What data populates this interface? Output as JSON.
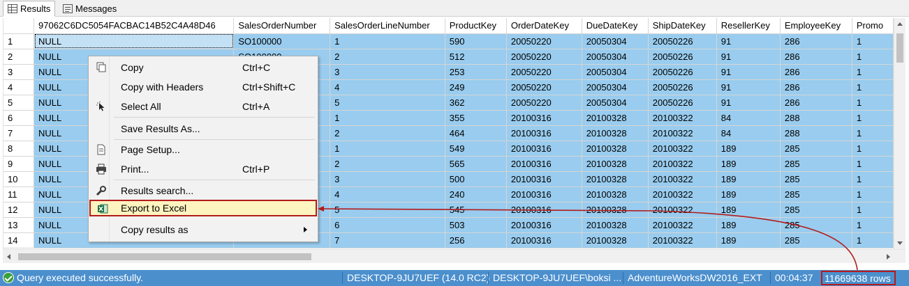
{
  "tabs": [
    {
      "label": "Results",
      "icon": "grid-icon",
      "active": true
    },
    {
      "label": "Messages",
      "icon": "message-icon",
      "active": false
    }
  ],
  "grid": {
    "columns": [
      "",
      "97062C6DC5054FACBAC14B52C4A48D46",
      "SalesOrderNumber",
      "SalesOrderLineNumber",
      "ProductKey",
      "OrderDateKey",
      "DueDateKey",
      "ShipDateKey",
      "ResellerKey",
      "EmployeeKey",
      "Promo"
    ],
    "rows": [
      [
        "1",
        "NULL",
        "SO100000",
        "1",
        "590",
        "20050220",
        "20050304",
        "20050226",
        "91",
        "286",
        "1"
      ],
      [
        "2",
        "NULL",
        "SO100000",
        "2",
        "512",
        "20050220",
        "20050304",
        "20050226",
        "91",
        "286",
        "1"
      ],
      [
        "3",
        "NULL",
        "",
        "3",
        "253",
        "20050220",
        "20050304",
        "20050226",
        "91",
        "286",
        "1"
      ],
      [
        "4",
        "NULL",
        "",
        "4",
        "249",
        "20050220",
        "20050304",
        "20050226",
        "91",
        "286",
        "1"
      ],
      [
        "5",
        "NULL",
        "",
        "5",
        "362",
        "20050220",
        "20050304",
        "20050226",
        "91",
        "286",
        "1"
      ],
      [
        "6",
        "NULL",
        "",
        "1",
        "355",
        "20100316",
        "20100328",
        "20100322",
        "84",
        "288",
        "1"
      ],
      [
        "7",
        "NULL",
        "",
        "2",
        "464",
        "20100316",
        "20100328",
        "20100322",
        "84",
        "288",
        "1"
      ],
      [
        "8",
        "NULL",
        "",
        "1",
        "549",
        "20100316",
        "20100328",
        "20100322",
        "189",
        "285",
        "1"
      ],
      [
        "9",
        "NULL",
        "",
        "2",
        "565",
        "20100316",
        "20100328",
        "20100322",
        "189",
        "285",
        "1"
      ],
      [
        "10",
        "NULL",
        "",
        "3",
        "500",
        "20100316",
        "20100328",
        "20100322",
        "189",
        "285",
        "1"
      ],
      [
        "11",
        "NULL",
        "",
        "4",
        "240",
        "20100316",
        "20100328",
        "20100322",
        "189",
        "285",
        "1"
      ],
      [
        "12",
        "NULL",
        "",
        "5",
        "545",
        "20100316",
        "20100328",
        "20100322",
        "189",
        "285",
        "1"
      ],
      [
        "13",
        "NULL",
        "",
        "6",
        "503",
        "20100316",
        "20100328",
        "20100322",
        "189",
        "285",
        "1"
      ],
      [
        "14",
        "NULL",
        "",
        "7",
        "256",
        "20100316",
        "20100328",
        "20100322",
        "189",
        "285",
        "1"
      ]
    ]
  },
  "context_menu": {
    "items": [
      {
        "label": "Copy",
        "shortcut": "Ctrl+C",
        "icon": "copy-icon"
      },
      {
        "label": "Copy with Headers",
        "shortcut": "Ctrl+Shift+C",
        "icon": ""
      },
      {
        "label": "Select All",
        "shortcut": "Ctrl+A",
        "icon": "select-all-icon"
      },
      {
        "label": "Save Results As...",
        "shortcut": "",
        "icon": ""
      },
      {
        "label": "Page Setup...",
        "shortcut": "",
        "icon": "page-setup-icon"
      },
      {
        "label": "Print...",
        "shortcut": "Ctrl+P",
        "icon": "printer-icon"
      },
      {
        "label": "Results search...",
        "shortcut": "",
        "icon": "search-wrench-icon"
      },
      {
        "label": "Export to Excel",
        "shortcut": "",
        "icon": "excel-icon",
        "highlighted": true
      },
      {
        "label": "Copy results as",
        "shortcut": "",
        "icon": "",
        "submenu": true
      }
    ]
  },
  "status": {
    "message": "Query executed successfully.",
    "server": "DESKTOP-9JU7UEF (14.0 RC2)",
    "user": "DESKTOP-9JU7UEF\\boksi ...",
    "database": "AdventureWorksDW2016_EXT",
    "elapsed": "00:04:37",
    "rows": "11669638 rows"
  },
  "colors": {
    "selection": "#99ccee",
    "status_bar": "#4b8fcd",
    "annotation": "#b31b1b",
    "menu_highlight": "#fdf4bf"
  }
}
